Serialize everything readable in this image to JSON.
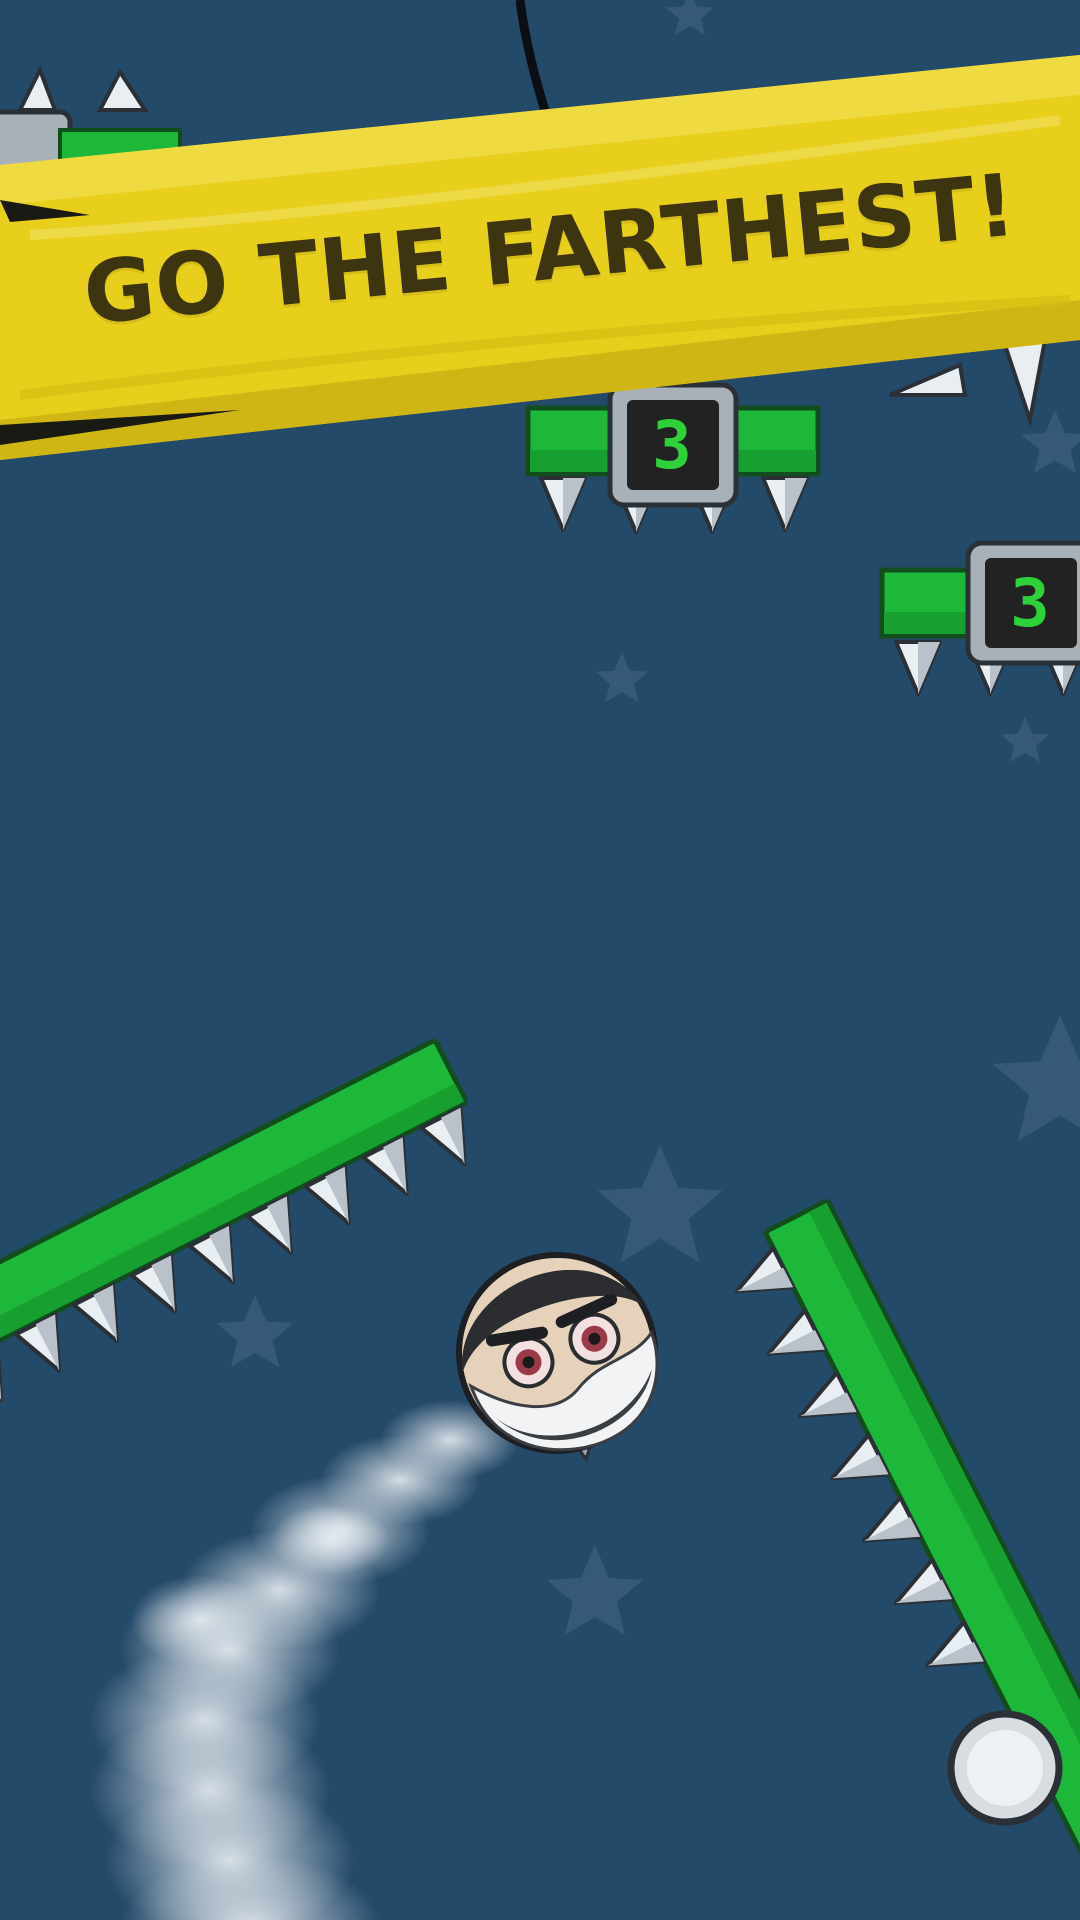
{
  "banner": {
    "text": "GO THE FARTHEST!"
  },
  "platforms": [
    {
      "id": "top-center",
      "counter": "3"
    },
    {
      "id": "mid-right",
      "counter": "3"
    }
  ],
  "colors": {
    "background": "#244a6a",
    "platform_green": "#1db83a",
    "banner_yellow": "#e8cf1c",
    "banner_text": "#3d3510",
    "counter_text": "#2ed13a"
  },
  "icons": [
    "star-icon",
    "spike-icon",
    "player-face-icon",
    "pivot-knob-icon"
  ]
}
